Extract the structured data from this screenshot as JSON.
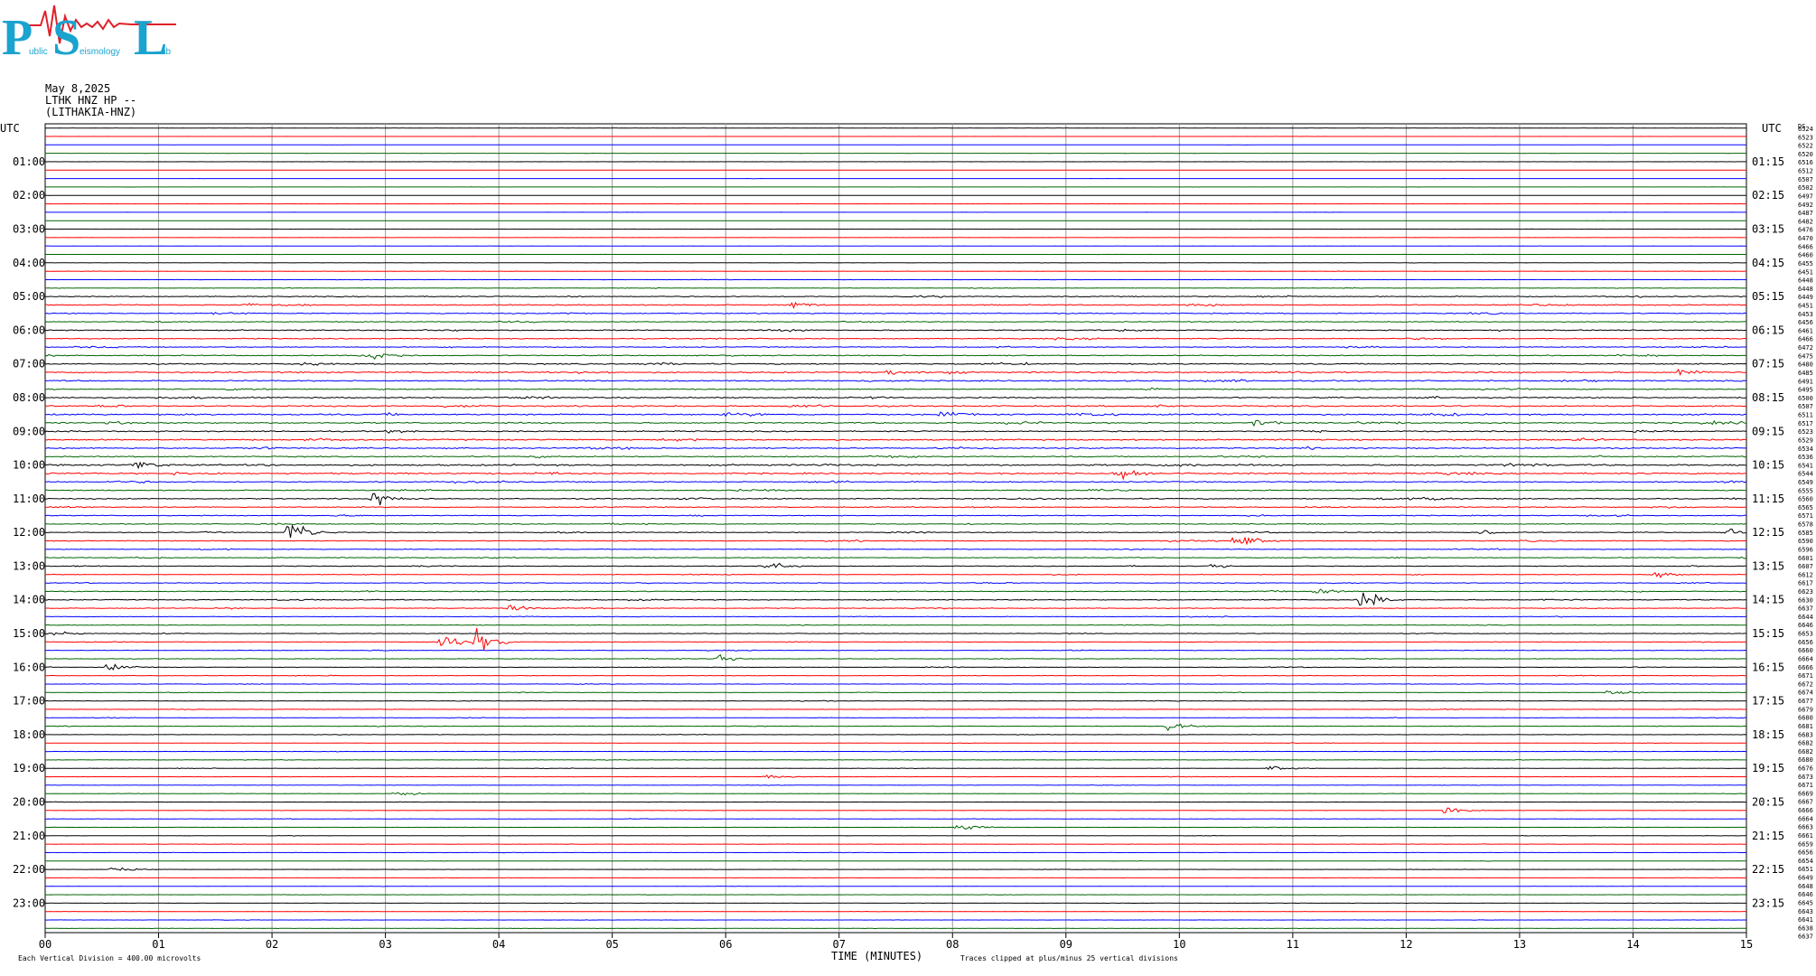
{
  "logo": {
    "letters": [
      "P",
      "S",
      "L"
    ],
    "words": [
      "ublic",
      "eismology",
      "ab"
    ],
    "colors": {
      "cyan": "#1aa3cf",
      "red": "#e0202a"
    }
  },
  "header": {
    "date": "May 8,2025",
    "station": "LTHK HNZ HP --",
    "site": "(LITHAKIA-HNZ)"
  },
  "axis": {
    "left_label": "UTC",
    "right_label": "UTC",
    "xlabel": "TIME (MINUTES)",
    "x_ticks": [
      "00",
      "01",
      "02",
      "03",
      "04",
      "05",
      "06",
      "07",
      "08",
      "09",
      "10",
      "11",
      "12",
      "13",
      "14",
      "15"
    ],
    "footer_left": "Each Vertical Division =  400.00 microvolts",
    "footer_right": "Traces clipped at plus/minus 25 vertical divisions"
  },
  "chart_data": {
    "type": "line",
    "title": "",
    "xlabel": "TIME (MINUTES)",
    "ylabel": "UTC",
    "xlim": [
      0,
      15
    ],
    "rows": 96,
    "minutes_per_row": 15,
    "grid": true,
    "trace_colors": [
      "#000000",
      "#ff0000",
      "#0000ff",
      "#006400"
    ],
    "left_hour_labels": [
      "01:00",
      "02:00",
      "03:00",
      "04:00",
      "05:00",
      "06:00",
      "07:00",
      "08:00",
      "09:00",
      "10:00",
      "11:00",
      "12:00",
      "13:00",
      "14:00",
      "15:00",
      "16:00",
      "17:00",
      "18:00",
      "19:00",
      "20:00",
      "21:00",
      "22:00",
      "23:00"
    ],
    "right_hour_labels": [
      "01:15",
      "02:15",
      "03:15",
      "04:15",
      "05:15",
      "06:15",
      "07:15",
      "08:15",
      "09:15",
      "10:15",
      "11:15",
      "12:15",
      "13:15",
      "14:15",
      "15:15",
      "16:15",
      "17:15",
      "18:15",
      "19:15",
      "20:15",
      "21:15",
      "22:15",
      "23:15"
    ],
    "right_count_label": "DS",
    "right_counts": [
      6524,
      6523,
      6522,
      6520,
      6516,
      6512,
      6507,
      6502,
      6497,
      6492,
      6487,
      6482,
      6476,
      6470,
      6466,
      6460,
      6455,
      6451,
      6448,
      6448,
      6449,
      6451,
      6453,
      6456,
      6461,
      6466,
      6472,
      6475,
      6480,
      6485,
      6491,
      6495,
      6500,
      6507,
      6511,
      6517,
      6523,
      6529,
      6534,
      6536,
      6541,
      6544,
      6549,
      6555,
      6560,
      6565,
      6571,
      6578,
      6585,
      6590,
      6596,
      6601,
      6607,
      6612,
      6617,
      6623,
      6630,
      6637,
      6644,
      6646,
      6653,
      6656,
      6660,
      6664,
      6666,
      6671,
      6672,
      6674,
      6677,
      6679,
      6680,
      6681,
      6683,
      6682,
      6682,
      6680,
      6676,
      6673,
      6671,
      6669,
      6667,
      6666,
      6664,
      6663,
      6661,
      6659,
      6656,
      6654,
      6651,
      6649,
      6648,
      6646,
      6645,
      6643,
      6641,
      6638,
      6637
    ],
    "activity_levels": [
      0.03,
      0.03,
      0.03,
      0.03,
      0.03,
      0.03,
      0.03,
      0.03,
      0.03,
      0.03,
      0.03,
      0.03,
      0.04,
      0.04,
      0.04,
      0.04,
      0.06,
      0.08,
      0.1,
      0.15,
      0.35,
      0.4,
      0.35,
      0.3,
      0.4,
      0.35,
      0.3,
      0.35,
      0.45,
      0.5,
      0.45,
      0.4,
      0.45,
      0.5,
      0.55,
      0.5,
      0.45,
      0.5,
      0.45,
      0.4,
      0.6,
      0.55,
      0.4,
      0.35,
      0.4,
      0.35,
      0.3,
      0.3,
      0.3,
      0.3,
      0.25,
      0.3,
      0.25,
      0.2,
      0.25,
      0.3,
      0.3,
      0.25,
      0.2,
      0.2,
      0.2,
      0.2,
      0.2,
      0.2,
      0.18,
      0.18,
      0.15,
      0.15,
      0.15,
      0.15,
      0.15,
      0.15,
      0.12,
      0.12,
      0.12,
      0.12,
      0.12,
      0.12,
      0.1,
      0.1,
      0.1,
      0.1,
      0.1,
      0.1,
      0.1,
      0.1,
      0.1,
      0.08,
      0.08,
      0.08,
      0.08,
      0.08,
      0.08,
      0.08,
      0.08,
      0.08
    ],
    "events": [
      {
        "row": 44,
        "minute": 2.9,
        "amplitude": 1.0
      },
      {
        "row": 48,
        "minute": 2.15,
        "amplitude": 1.3
      },
      {
        "row": 48,
        "minute": 2.2,
        "amplitude": 0.9
      },
      {
        "row": 52,
        "minute": 6.35,
        "amplitude": 0.6
      },
      {
        "row": 49,
        "minute": 10.5,
        "amplitude": 1.2
      },
      {
        "row": 56,
        "minute": 11.6,
        "amplitude": 1.4
      },
      {
        "row": 57,
        "minute": 4.1,
        "amplitude": 0.6
      },
      {
        "row": 61,
        "minute": 3.8,
        "amplitude": 1.5
      },
      {
        "row": 61,
        "minute": 3.5,
        "amplitude": 1.2
      },
      {
        "row": 60,
        "minute": 0.05,
        "amplitude": 0.6
      },
      {
        "row": 71,
        "minute": 9.9,
        "amplitude": 0.7
      },
      {
        "row": 67,
        "minute": 13.8,
        "amplitude": 0.6
      },
      {
        "row": 41,
        "minute": 9.45,
        "amplitude": 0.7
      },
      {
        "row": 40,
        "minute": 0.8,
        "amplitude": 0.7
      },
      {
        "row": 27,
        "minute": 2.9,
        "amplitude": 0.7
      },
      {
        "row": 29,
        "minute": 7.45,
        "amplitude": 0.6
      },
      {
        "row": 29,
        "minute": 14.4,
        "amplitude": 0.6
      },
      {
        "row": 34,
        "minute": 7.9,
        "amplitude": 0.5
      },
      {
        "row": 21,
        "minute": 1.75,
        "amplitude": 0.5
      },
      {
        "row": 21,
        "minute": 6.6,
        "amplitude": 0.5
      },
      {
        "row": 53,
        "minute": 14.2,
        "amplitude": 0.5
      },
      {
        "row": 55,
        "minute": 11.2,
        "amplitude": 0.6
      },
      {
        "row": 83,
        "minute": 8.05,
        "amplitude": 0.6
      },
      {
        "row": 77,
        "minute": 6.35,
        "amplitude": 0.6
      },
      {
        "row": 81,
        "minute": 12.35,
        "amplitude": 0.5
      },
      {
        "row": 64,
        "minute": 0.55,
        "amplitude": 0.5
      },
      {
        "row": 63,
        "minute": 5.95,
        "amplitude": 0.6
      },
      {
        "row": 35,
        "minute": 10.65,
        "amplitude": 0.6
      },
      {
        "row": 44,
        "minute": 12.15,
        "amplitude": 0.5
      },
      {
        "row": 48,
        "minute": 12.65,
        "amplitude": 0.5
      },
      {
        "row": 48,
        "minute": 14.85,
        "amplitude": 0.5
      },
      {
        "row": 52,
        "minute": 10.3,
        "amplitude": 0.4
      },
      {
        "row": 76,
        "minute": 10.8,
        "amplitude": 0.4
      },
      {
        "row": 79,
        "minute": 3.1,
        "amplitude": 0.4
      },
      {
        "row": 88,
        "minute": 0.6,
        "amplitude": 0.4
      }
    ]
  }
}
